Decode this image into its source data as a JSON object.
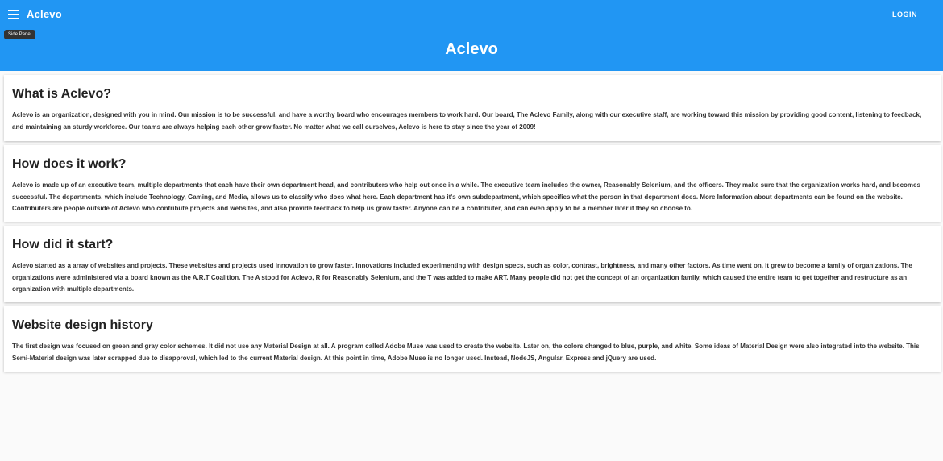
{
  "header": {
    "brand": "Aclevo",
    "login_label": "LOGIN",
    "tooltip": "Side Panel",
    "hero_title": "Aclevo",
    "menu_icon": "hamburger-menu-icon",
    "color": "#2196f3"
  },
  "sections": [
    {
      "title": "What is Aclevo?",
      "body": "Aclevo is an organization, designed with you in mind. Our mission is to be successful, and have a worthy board who encourages members to work hard. Our board, The Aclevo Family, along with our executive staff, are working toward this mission by providing good content, listening to feedback, and maintaining an sturdy workforce. Our teams are always helping each other grow faster. No matter what we call ourselves, Aclevo is here to stay since the year of 2009!"
    },
    {
      "title": "How does it work?",
      "body": "Aclevo is made up of an executive team, multiple departments that each have their own department head, and contributers who help out once in a while. The executive team includes the owner, Reasonably Selenium, and the officers. They make sure that the organization works hard, and becomes successful. The departments, which include Technology, Gaming, and Media, allows us to classify who does what here. Each department has it's own subdepartment, which specifies what the person in that department does. More Information about departments can be found on the website. Contributers are people outside of Aclevo who contribute projects and websites, and also provide feedback to help us grow faster. Anyone can be a contributer, and can even apply to be a member later if they so choose to."
    },
    {
      "title": "How did it start?",
      "body": "Aclevo started as a array of websites and projects. These websites and projects used innovation to grow faster. Innovations included experimenting with design specs, such as color, contrast, brightness, and many other factors. As time went on, it grew to become a family of organizations. The organizations were administered via a board known as the A.R.T Coalition. The A stood for Aclevo, R for Reasonably Selenium, and the T was added to make ART. Many people did not get the concept of an organization family, which caused the entire team to get together and restructure as an organization with multiple departments."
    },
    {
      "title": "Website design history",
      "body": "The first design was focused on green and gray color schemes. It did not use any Material Design at all. A program called Adobe Muse was used to create the website. Later on, the colors changed to blue, purple, and white. Some ideas of Material Design were also integrated into the website. This Semi-Material design was later scrapped due to disapproval, which led to the current Material design. At this point in time, Adobe Muse is no longer used. Instead, NodeJS, Angular, Express and jQuery are used."
    }
  ]
}
